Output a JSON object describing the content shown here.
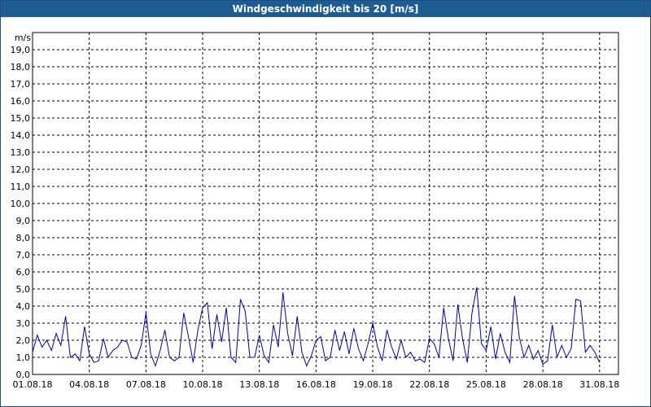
{
  "window": {
    "title": "Windgeschwindigkeit bis 20 [m/s]"
  },
  "chart_data": {
    "type": "line",
    "title": "Windgeschwindigkeit bis 20 [m/s]",
    "ylabel": "m/s",
    "xlabel": "",
    "ylim": [
      0,
      20
    ],
    "xlim": [
      "01.08.18",
      "01.09.18"
    ],
    "grid": true,
    "line_color": "#0000a0",
    "y_ticks": [
      "0,0",
      "1,0",
      "2,0",
      "3,0",
      "4,0",
      "5,0",
      "6,0",
      "7,0",
      "8,0",
      "9,0",
      "10,0",
      "11,0",
      "12,0",
      "13,0",
      "14,0",
      "15,0",
      "16,0",
      "17,0",
      "18,0",
      "19,0"
    ],
    "x_ticks": [
      "01.08.18",
      "04.08.18",
      "07.08.18",
      "10.08.18",
      "13.08.18",
      "16.08.18",
      "19.08.18",
      "22.08.18",
      "25.08.18",
      "28.08.18",
      "31.08.18"
    ],
    "series": [
      {
        "x_days": [
          0,
          0.25,
          0.5,
          0.75,
          1,
          1.25,
          1.5,
          1.75,
          2,
          2.25,
          2.5,
          2.75,
          3,
          3.25,
          3.5,
          3.75,
          4,
          4.25,
          4.5,
          4.75,
          5,
          5.25,
          5.5,
          5.75,
          6,
          6.25,
          6.5,
          6.75,
          7,
          7.25,
          7.5,
          7.75,
          8,
          8.25,
          8.5,
          8.75,
          9,
          9.25,
          9.5,
          9.75,
          10,
          10.25,
          10.5,
          10.75,
          11,
          11.25,
          11.5,
          11.75,
          12,
          12.25,
          12.5,
          12.75,
          13,
          13.25,
          13.5,
          13.75,
          14,
          14.25,
          14.5,
          14.75,
          15,
          15.25,
          15.5,
          15.75,
          16,
          16.25,
          16.5,
          16.75,
          17,
          17.25,
          17.5,
          17.75,
          18,
          18.25,
          18.5,
          18.75,
          19,
          19.25,
          19.5,
          19.75,
          20,
          20.25,
          20.5,
          20.75,
          21,
          21.25,
          21.5,
          21.75,
          22,
          22.25,
          22.5,
          22.75,
          23,
          23.25,
          23.5,
          23.75,
          24,
          24.25,
          24.5,
          24.75,
          25,
          25.25,
          25.5,
          25.75,
          26,
          26.25,
          26.5,
          26.75,
          27,
          27.25,
          27.5,
          27.75,
          28,
          28.25,
          28.5,
          28.75,
          29,
          29.25,
          29.5,
          29.75,
          30,
          30.25,
          30.5,
          30.75,
          31
        ],
        "values": [
          1.3,
          2.3,
          1.6,
          2.0,
          1.4,
          2.4,
          1.7,
          3.4,
          1.0,
          1.2,
          0.8,
          2.8,
          1.2,
          0.7,
          0.8,
          2.1,
          1.0,
          1.4,
          1.6,
          2.0,
          1.9,
          1.0,
          0.9,
          1.7,
          3.6,
          1.2,
          0.5,
          1.4,
          2.6,
          1.0,
          0.8,
          1.0,
          3.6,
          2.2,
          0.7,
          2.6,
          3.9,
          4.2,
          1.5,
          3.5,
          1.9,
          3.9,
          1.0,
          0.7,
          4.4,
          3.7,
          1.0,
          1.0,
          2.3,
          1.1,
          0.7,
          2.9,
          1.6,
          4.8,
          2.4,
          1.1,
          3.4,
          1.3,
          0.5,
          1.1,
          2.0,
          2.2,
          0.8,
          1.0,
          2.6,
          1.4,
          2.5,
          1.2,
          2.7,
          1.5,
          0.8,
          1.8,
          3.0,
          1.6,
          0.8,
          2.6,
          1.6,
          0.9,
          2.0,
          1.0,
          1.3,
          0.8,
          0.9,
          0.7,
          2.1,
          1.8,
          1.0,
          3.9,
          2.1,
          0.8,
          4.1,
          2.1,
          0.7,
          3.6,
          5.1,
          1.8,
          1.4,
          2.8,
          0.9,
          2.4,
          1.3,
          0.7,
          4.6,
          2.2,
          1.0,
          1.7,
          0.9,
          1.4,
          0.6,
          0.8,
          2.9,
          1.0,
          1.7,
          1.0,
          1.5,
          4.4,
          4.3,
          1.3,
          1.7,
          1.3,
          0.7
        ]
      }
    ]
  }
}
